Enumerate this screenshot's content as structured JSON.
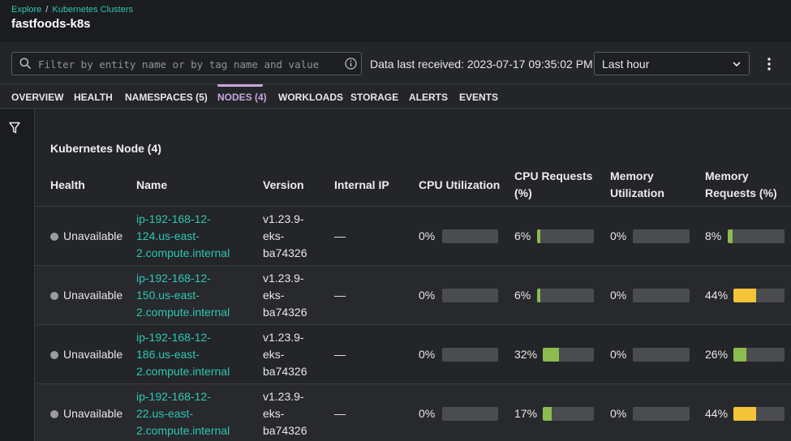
{
  "breadcrumb": {
    "root": "Explore",
    "separator": "/",
    "current": "Kubernetes Clusters"
  },
  "page_title": "fastfoods-k8s",
  "toolbar": {
    "filter_placeholder": "Filter by entity name or by tag name and value",
    "last_received": "Data last received: 2023-07-17 09:35:02 PM",
    "time_range": "Last hour"
  },
  "tabs": [
    {
      "label": "OVERVIEW"
    },
    {
      "label": "HEALTH"
    },
    {
      "label": "NAMESPACES (5)"
    },
    {
      "label": "NODES (4)",
      "active": true
    },
    {
      "label": "WORKLOADS"
    },
    {
      "label": "STORAGE"
    },
    {
      "label": "ALERTS"
    },
    {
      "label": "EVENTS"
    }
  ],
  "section_title": "Kubernetes Node (4)",
  "columns": {
    "health": "Health",
    "name": "Name",
    "version": "Version",
    "internal_ip": "Internal IP",
    "cpu_util": "CPU Utilization",
    "cpu_req_1": "CPU Requests",
    "cpu_req_2": "(%)",
    "mem_util_1": "Memory",
    "mem_util_2": "Utilization",
    "mem_req_1": "Memory",
    "mem_req_2": "Requests (%)"
  },
  "colors": {
    "accent": "#2dc7b3",
    "active_tab": "#c9a6df",
    "bar_green": "#8cbc4f",
    "bar_yellow": "#f4c338",
    "bar_track": "#4a4c50",
    "status_gray": "#9a9c9f"
  },
  "rows": [
    {
      "health": "Unavailable",
      "name": [
        "ip-192-168-12-",
        "124.us-east-",
        "2.compute.internal"
      ],
      "version": [
        "v1.23.9-",
        "eks-",
        "ba74326"
      ],
      "ip": "—",
      "cpu_util": "0%",
      "cpu_req": "6%",
      "mem_util": "0%",
      "mem_req": "8%"
    },
    {
      "health": "Unavailable",
      "name": [
        "ip-192-168-12-",
        "150.us-east-",
        "2.compute.internal"
      ],
      "version": [
        "v1.23.9-",
        "eks-",
        "ba74326"
      ],
      "ip": "—",
      "cpu_util": "0%",
      "cpu_req": "6%",
      "mem_util": "0%",
      "mem_req": "44%"
    },
    {
      "health": "Unavailable",
      "name": [
        "ip-192-168-12-",
        "186.us-east-",
        "2.compute.internal"
      ],
      "version": [
        "v1.23.9-",
        "eks-",
        "ba74326"
      ],
      "ip": "—",
      "cpu_util": "0%",
      "cpu_req": "32%",
      "mem_util": "0%",
      "mem_req": "26%"
    },
    {
      "health": "Unavailable",
      "name": [
        "ip-192-168-12-",
        "22.us-east-",
        "2.compute.internal"
      ],
      "version": [
        "v1.23.9-",
        "eks-",
        "ba74326"
      ],
      "ip": "—",
      "cpu_util": "0%",
      "cpu_req": "17%",
      "mem_util": "0%",
      "mem_req": "44%"
    }
  ]
}
